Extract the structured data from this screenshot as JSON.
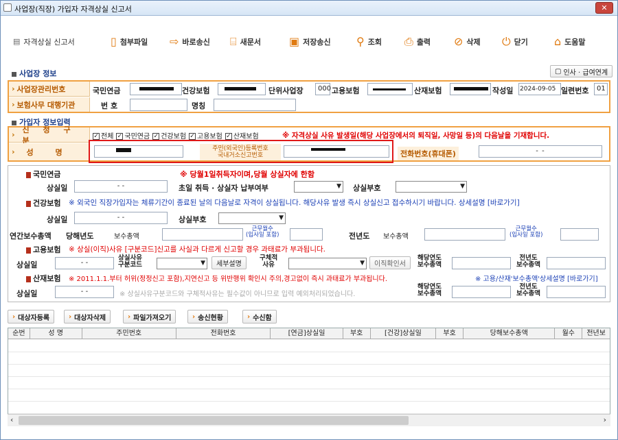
{
  "window": {
    "title": "사업장(직장) 가입자 자격상실 신고서",
    "close": "✕"
  },
  "toolbar": {
    "form_name": "자격상실 신고서",
    "buttons": [
      {
        "label": "첨부파일",
        "icon": "paperclip-icon",
        "glyph": "📄"
      },
      {
        "label": "바로송신",
        "icon": "send-arrow-icon",
        "glyph": "⇨"
      },
      {
        "label": "새문서",
        "icon": "new-document-icon",
        "glyph": "📖"
      },
      {
        "label": "저장송신",
        "icon": "save-icon",
        "glyph": "💾"
      },
      {
        "label": "조회",
        "icon": "search-icon",
        "glyph": "🔍"
      },
      {
        "label": "출력",
        "icon": "printer-icon",
        "glyph": "🖶"
      },
      {
        "label": "삭제",
        "icon": "delete-icon",
        "glyph": "⊘"
      },
      {
        "label": "닫기",
        "icon": "power-icon",
        "glyph": "⏻"
      },
      {
        "label": "도움말",
        "icon": "help-hat-icon",
        "glyph": "🎓"
      }
    ]
  },
  "workplace": {
    "section_title": "사업장 정보",
    "link_button": "인사 · 급여연계",
    "mgmt_no_label": "사업장관리번호",
    "pension_label": "국민연금",
    "health_label": "건강보험",
    "unit_label": "단위사업장",
    "unit_value": "000",
    "employment_label": "고용보험",
    "industrial_label": "산재보험",
    "date_label": "작성일",
    "date_value": "2024-09-05",
    "serial_label": "일련번호",
    "serial_value": "01",
    "agency_label": "보험사무 대행기관",
    "agency_no_label": "번 호",
    "agency_name_label": "명칭"
  },
  "subscriber": {
    "section_title": "가입자 정보입력",
    "apply_label": "신 청 구 분",
    "checks": [
      "전체",
      "국민연금",
      "건강보험",
      "고용보험",
      "산재보험"
    ],
    "notice": "※ 자격상실 사유 발생일(해당 사업장에서의 퇴직일, 사망일 등)의 다음날을 기재합니다.",
    "name_label": "성 명",
    "rrn_label_1": "주민(외국인)등록번호",
    "rrn_label_2": "국내거소신고번호",
    "phone_label": "전화번호(휴대폰)",
    "phone_value": "-          -"
  },
  "pension": {
    "title": "국민연금",
    "notice": "※ 당월1일취득자이며,당월 상실자에 한함",
    "loss_date_label": "상실일",
    "loss_date_value": "-  -",
    "first_month_label": "초일 취득 · 상실자 납부여부",
    "code_label": "상실부호"
  },
  "health": {
    "title": "건강보험",
    "notice": "※ 외국인 직장가입자는 체류기간이 종료된 날의 다음날로 자격이 상실됩니다. 해당사유 발생 즉시 상실신고 접수하시기 바랍니다. 상세설명 [바로가기]",
    "loss_date_label": "상실일",
    "loss_date_value": "-  -",
    "code_label": "상실부호",
    "annual_total_label": "연간보수총액",
    "this_year_label": "당해년도",
    "pay_total_label": "보수총액",
    "work_months_label_1": "근무월수",
    "work_months_label_2": "(입사일 포함)",
    "prev_year_label": "전년도",
    "prev_pay_label": "보수총액",
    "prev_work_1": "근무월수",
    "prev_work_2": "(입사일 포함)"
  },
  "employment": {
    "title": "고용보험",
    "notice": "※ 상실(이직)사유 [구분코드]신고를 사실과 다르게 신고할 경우 과태료가 부과됩니다.",
    "loss_date_label": "상실일",
    "loss_date_value": "-  -",
    "reason_code_1": "상실사유",
    "reason_code_2": "구분코드",
    "detail_button": "세부설명",
    "specific_1": "구체적",
    "specific_2": "사유",
    "confirm_button": "이직확인서",
    "this_year_1": "해당연도",
    "this_year_2": "보수총액",
    "prev_year_1": "전년도",
    "prev_year_2": "보수총액"
  },
  "industrial": {
    "title": "산재보험",
    "notice_red": "※ 2011.1.1.부터 허위(정정신고 포함),지연신고 등 위반행위 확인시 주의,경고없이 즉시 과태료가 부과됩니다.",
    "notice_blue": "※ 고용/산재'보수총액'상세설명 [바로가기]",
    "loss_date_label": "상실일",
    "loss_date_value": "-  -",
    "placeholder": "※ 상실사유구분코드와 구체적사유는 필수값이 아니므로 입력 예외처리되었습니다.",
    "this_year_1": "해당연도",
    "this_year_2": "보수총액",
    "prev_year_1": "전년도",
    "prev_year_2": "보수총액"
  },
  "actions": [
    "대상자등록",
    "대상자삭제",
    "파일가져오기",
    "송신현황",
    "수신함"
  ],
  "table": {
    "columns": [
      "순번",
      "성 명",
      "주민번호",
      "전화번호",
      "[연금]상실일",
      "부호",
      "[건강]상실일",
      "부호",
      "당해보수총액",
      "월수",
      "전년보"
    ]
  },
  "colors": {
    "accent_orange": "#f0a040",
    "notice_red": "#e00000",
    "link_blue": "#1a3fb5",
    "highlight_red": "#e01818"
  }
}
